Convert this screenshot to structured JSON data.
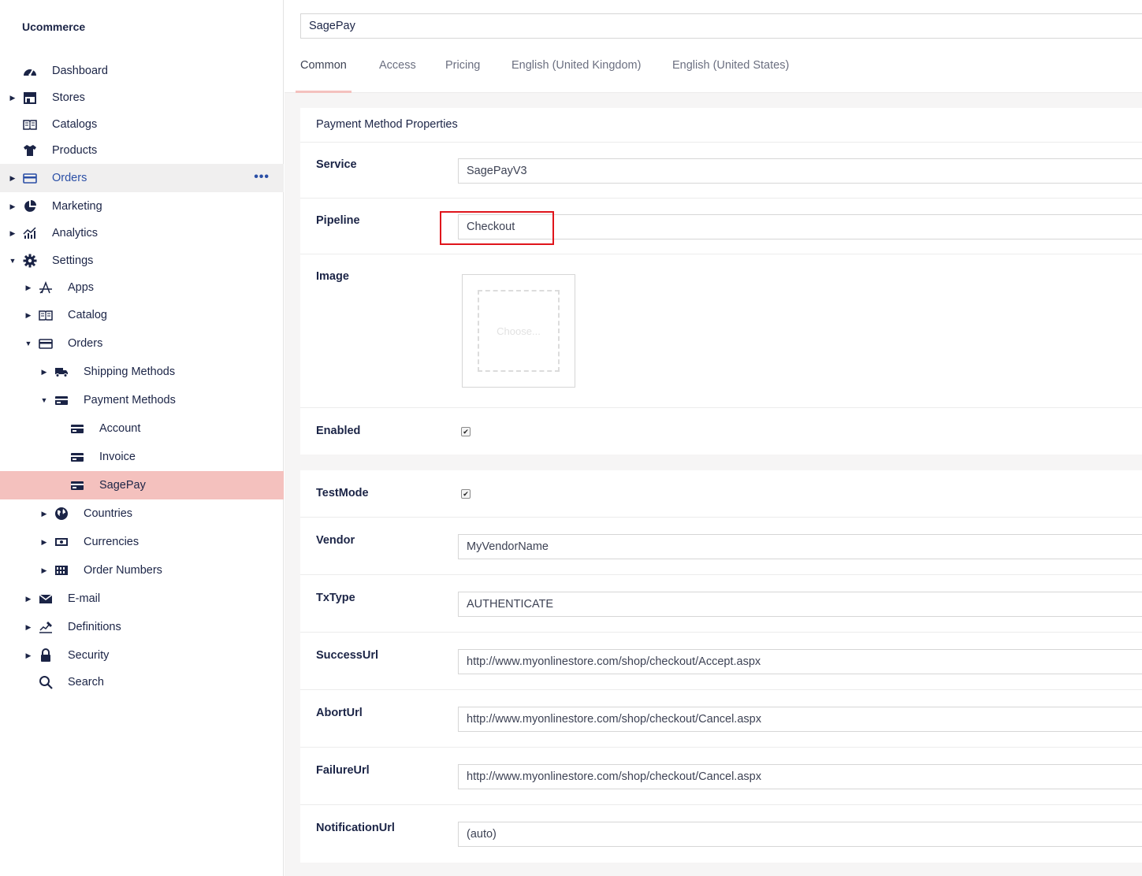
{
  "app": {
    "brand": "Ucommerce"
  },
  "sidebar": {
    "items": [
      {
        "label": "Dashboard",
        "icon": "dashboard-icon"
      },
      {
        "label": "Stores",
        "icon": "store-icon"
      },
      {
        "label": "Catalogs",
        "icon": "book-icon"
      },
      {
        "label": "Products",
        "icon": "tshirt-icon"
      },
      {
        "label": "Orders",
        "icon": "card-icon"
      },
      {
        "label": "Marketing",
        "icon": "pie-icon"
      },
      {
        "label": "Analytics",
        "icon": "chart-icon"
      },
      {
        "label": "Settings",
        "icon": "gear-icon"
      },
      {
        "label": "Apps",
        "icon": "apps-icon"
      },
      {
        "label": "Catalog",
        "icon": "book-icon"
      },
      {
        "label": "Orders",
        "icon": "card-icon"
      },
      {
        "label": "Shipping Methods",
        "icon": "truck-icon"
      },
      {
        "label": "Payment Methods",
        "icon": "card-icon"
      },
      {
        "label": "Account",
        "icon": "card-icon"
      },
      {
        "label": "Invoice",
        "icon": "card-icon"
      },
      {
        "label": "SagePay",
        "icon": "card-icon"
      },
      {
        "label": "Countries",
        "icon": "globe-icon"
      },
      {
        "label": "Currencies",
        "icon": "money-icon"
      },
      {
        "label": "Order Numbers",
        "icon": "numbers-icon"
      },
      {
        "label": "E-mail",
        "icon": "envelope-icon"
      },
      {
        "label": "Definitions",
        "icon": "definitions-icon"
      },
      {
        "label": "Security",
        "icon": "lock-icon"
      },
      {
        "label": "Search",
        "icon": "search-icon"
      }
    ],
    "more_glyph": "•••"
  },
  "header": {
    "title_value": "SagePay",
    "tabs": [
      {
        "label": "Common"
      },
      {
        "label": "Access"
      },
      {
        "label": "Pricing"
      },
      {
        "label": "English (United Kingdom)"
      },
      {
        "label": "English (United States)"
      }
    ]
  },
  "properties": {
    "heading": "Payment Method Properties",
    "service": {
      "label": "Service",
      "value": "SagePayV3"
    },
    "pipeline": {
      "label": "Pipeline",
      "value": "Checkout"
    },
    "image": {
      "label": "Image",
      "placeholder": "Choose..."
    },
    "enabled": {
      "label": "Enabled",
      "checked": true
    }
  },
  "config": {
    "testmode": {
      "label": "TestMode",
      "checked": true
    },
    "vendor": {
      "label": "Vendor",
      "value": "MyVendorName"
    },
    "txtype": {
      "label": "TxType",
      "value": "AUTHENTICATE"
    },
    "successurl": {
      "label": "SuccessUrl",
      "value": "http://www.myonlinestore.com/shop/checkout/Accept.aspx"
    },
    "aborturl": {
      "label": "AbortUrl",
      "value": "http://www.myonlinestore.com/shop/checkout/Cancel.aspx"
    },
    "failureurl": {
      "label": "FailureUrl",
      "value": "http://www.myonlinestore.com/shop/checkout/Cancel.aspx"
    },
    "notificationurl": {
      "label": "NotificationUrl",
      "value": "(auto)"
    }
  },
  "colors": {
    "navy": "#1b2446",
    "selected": "#f4c1be",
    "accent_blue": "#2b4fa6",
    "highlight_red": "#e0141b"
  }
}
